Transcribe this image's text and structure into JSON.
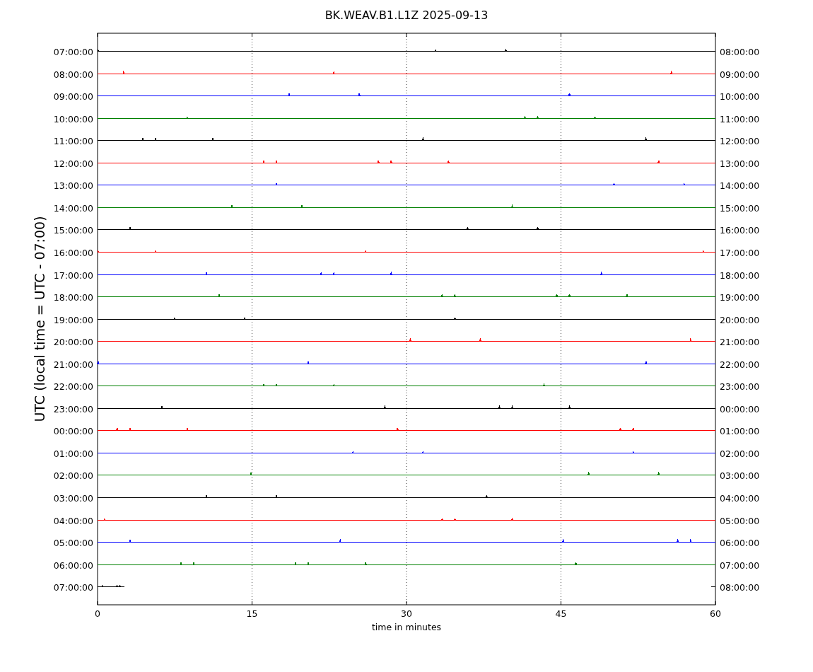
{
  "title": "BK.WEAV.B1.L1Z 2025-09-13",
  "y_axis_label": "UTC (local time = UTC - 07:00)",
  "x_axis_label": "time in minutes",
  "x_ticks": [
    "0",
    "15",
    "30",
    "45",
    "60"
  ],
  "rows": [
    {
      "left": "07:00:00",
      "right": "08:00:00",
      "color": "#000000",
      "kind": "full"
    },
    {
      "left": "08:00:00",
      "right": "09:00:00",
      "color": "#ff0000",
      "kind": "full"
    },
    {
      "left": "09:00:00",
      "right": "10:00:00",
      "color": "#0000ff",
      "kind": "full"
    },
    {
      "left": "10:00:00",
      "right": "11:00:00",
      "color": "#008000",
      "kind": "full"
    },
    {
      "left": "11:00:00",
      "right": "12:00:00",
      "color": "#000000",
      "kind": "full"
    },
    {
      "left": "12:00:00",
      "right": "13:00:00",
      "color": "#ff0000",
      "kind": "full"
    },
    {
      "left": "13:00:00",
      "right": "14:00:00",
      "color": "#0000ff",
      "kind": "full"
    },
    {
      "left": "14:00:00",
      "right": "15:00:00",
      "color": "#008000",
      "kind": "full"
    },
    {
      "left": "15:00:00",
      "right": "16:00:00",
      "color": "#000000",
      "kind": "full"
    },
    {
      "left": "16:00:00",
      "right": "17:00:00",
      "color": "#ff0000",
      "kind": "full"
    },
    {
      "left": "17:00:00",
      "right": "18:00:00",
      "color": "#0000ff",
      "kind": "full"
    },
    {
      "left": "18:00:00",
      "right": "19:00:00",
      "color": "#008000",
      "kind": "full"
    },
    {
      "left": "19:00:00",
      "right": "20:00:00",
      "color": "#000000",
      "kind": "full"
    },
    {
      "left": "20:00:00",
      "right": "21:00:00",
      "color": "#ff0000",
      "kind": "full"
    },
    {
      "left": "21:00:00",
      "right": "22:00:00",
      "color": "#0000ff",
      "kind": "full"
    },
    {
      "left": "22:00:00",
      "right": "23:00:00",
      "color": "#008000",
      "kind": "full"
    },
    {
      "left": "23:00:00",
      "right": "00:00:00",
      "color": "#000000",
      "kind": "full"
    },
    {
      "left": "00:00:00",
      "right": "01:00:00",
      "color": "#ff0000",
      "kind": "full"
    },
    {
      "left": "01:00:00",
      "right": "02:00:00",
      "color": "#0000ff",
      "kind": "full"
    },
    {
      "left": "02:00:00",
      "right": "03:00:00",
      "color": "#008000",
      "kind": "full"
    },
    {
      "left": "03:00:00",
      "right": "04:00:00",
      "color": "#000000",
      "kind": "full"
    },
    {
      "left": "04:00:00",
      "right": "05:00:00",
      "color": "#ff0000",
      "kind": "full"
    },
    {
      "left": "05:00:00",
      "right": "06:00:00",
      "color": "#0000ff",
      "kind": "full"
    },
    {
      "left": "06:00:00",
      "right": "07:00:00",
      "color": "#008000",
      "kind": "full"
    },
    {
      "left": "07:00:00",
      "right": "08:00:00",
      "color": "#000000",
      "kind": "partial"
    }
  ]
}
